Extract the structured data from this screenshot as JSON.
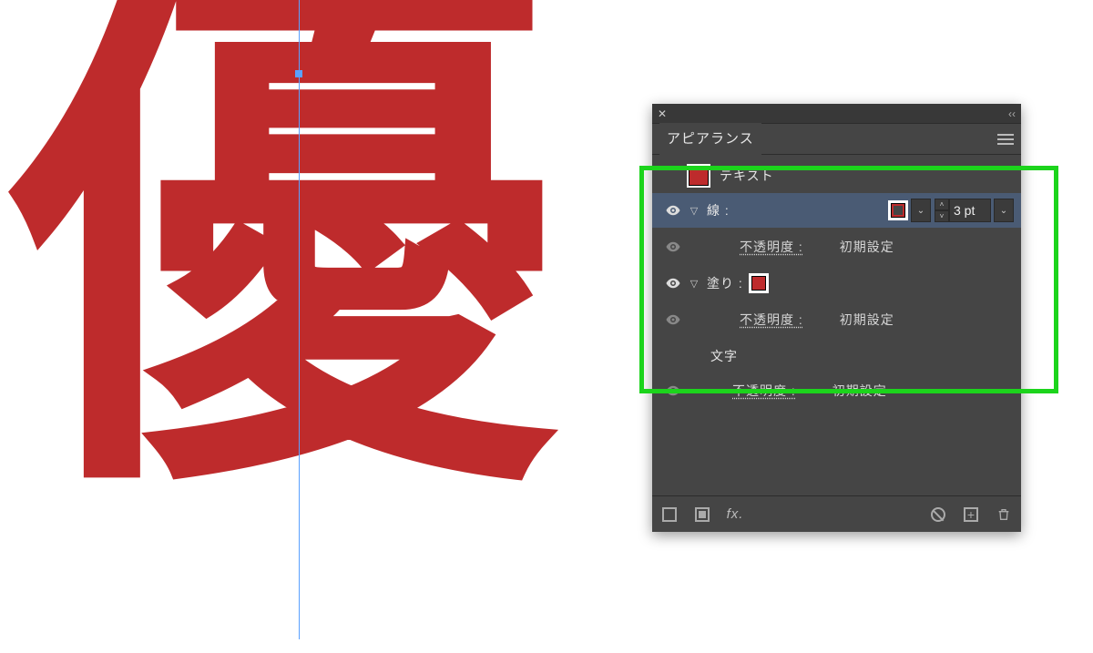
{
  "canvas": {
    "glyph": "優"
  },
  "panel": {
    "title": "アピアランス",
    "header": {
      "label": "テキスト"
    },
    "stroke": {
      "label": "線 :",
      "weight": "3 pt",
      "opacity_label": "不透明度 :",
      "opacity_value": "初期設定",
      "color": "#be2b2c"
    },
    "fill": {
      "label": "塗り :",
      "opacity_label": "不透明度 :",
      "opacity_value": "初期設定",
      "color": "#be2b2c"
    },
    "characters": {
      "label": "文字"
    },
    "object_opacity": {
      "label": "不透明度 :",
      "value": "初期設定"
    },
    "footer": {
      "fx_label": "fx."
    }
  }
}
